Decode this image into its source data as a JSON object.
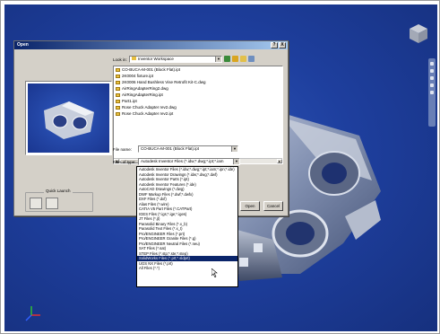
{
  "dialog": {
    "title": "Open",
    "help_btn": "?",
    "close_btn": "X",
    "look_in_label": "Look in:",
    "look_in_value": "Inventor Workspace",
    "file_name_label": "File name:",
    "file_name_value": "CO-BUCA-M-001 (Block Flat).ipt",
    "files_of_type_label": "Files of type:",
    "files_of_type_value": "Autodesk Inventor Files (*.idw;*.dwg;*.ipt;*.iam",
    "quick_launch_label": "Quick Launch",
    "open_btn": "Open",
    "cancel_btn": "Cancel"
  },
  "files": [
    "CO-BUCA-M-001 (Block Flat).ipt",
    "2K0004 fixture.ipt",
    "2K0006 Hand Bushless Vise Retrofit Kit-C.dwg",
    "AirRingAdapterRing2.dwg",
    "AirRingAdapterRing.ipt",
    "Part1.ipt",
    "Rose Chuck Adapter rev2.dwg",
    "Rose Chuck Adapter rev2.ipt"
  ],
  "dropdown_items": [
    "Autodesk Inventor Files (*.idw;*.dwg;*.ipt;*.iam;*.ipn;*.ide)",
    "Autodesk Inventor Drawings (*.idw;*.dwg;*.dwf)",
    "Autodesk Inventor Parts (*.ipt)",
    "Autodesk Inventor Features (*.ide)",
    "AutoCAD Drawings (*.dwg)",
    "DWF Markup Files (*.dwf;*.dwfx)",
    "DXF Files (*.dxf)",
    "Alias Files (*.wire)",
    "CATIA V5 Part Files (*.CATPart)",
    "IGES Files (*.igs;*.ige;*.iges)",
    "JT Files (*.jt)",
    "Parasolid Binary Files (*.x_b)",
    "Parasolid Text Files (*.x_t)",
    "Pro/ENGINEER Files (*.prt)",
    "Pro/ENGINEER Granite Files (*.g)",
    "Pro/ENGINEER Neutral Files (*.neu)",
    "SAT Files (*.sat)",
    "STEP Files (*.stp;*.ste;*.step)",
    "SolidWorks Files (*.prt;*.sldprt)",
    "UGS NX Files (*.prt)",
    "All Files (*.*)"
  ],
  "highlighted_dropdown_index": 18,
  "colors": {
    "viewport": "#1e3f9e",
    "titlebar": "#0a246a",
    "selection": "#0a246a",
    "dialog": "#d4d0c8"
  },
  "icons": [
    "folder-icon",
    "back-icon",
    "up-folder-icon",
    "new-folder-icon",
    "views-menu-icon",
    "view-cube-icon",
    "axis-triad-icon",
    "mouse-cursor-icon"
  ]
}
